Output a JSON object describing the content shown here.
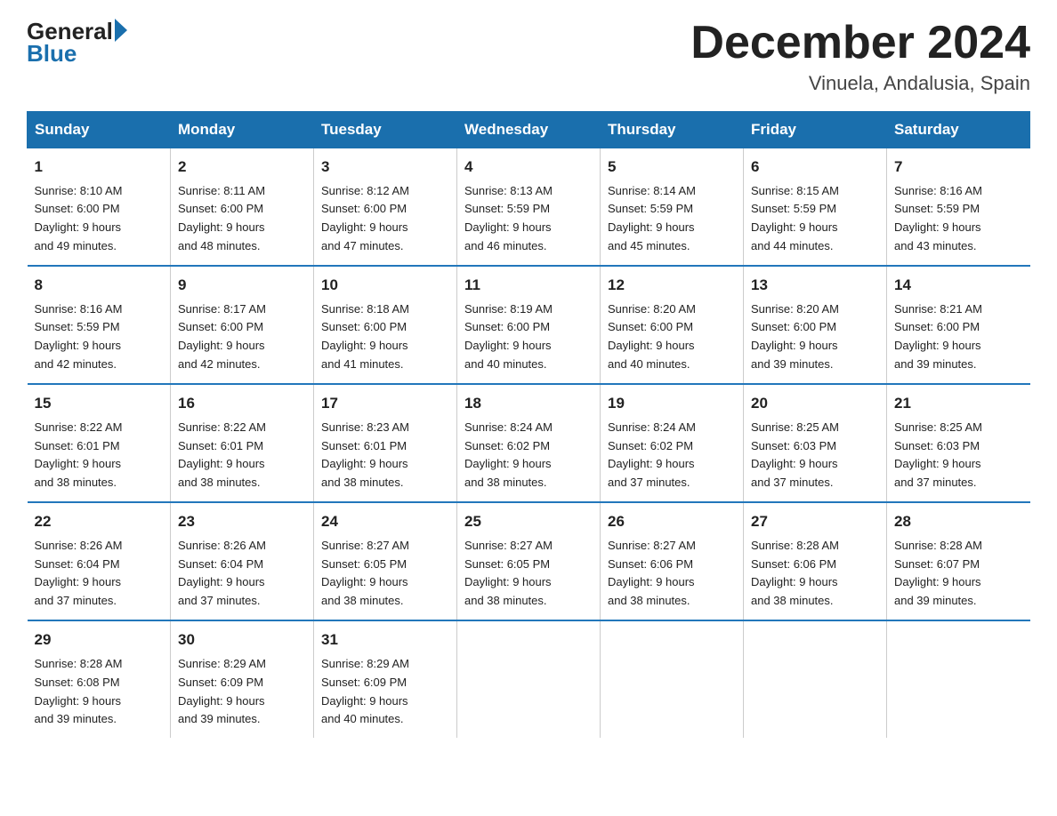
{
  "header": {
    "logo_general": "General",
    "logo_blue": "Blue",
    "month_title": "December 2024",
    "location": "Vinuela, Andalusia, Spain"
  },
  "days_of_week": [
    "Sunday",
    "Monday",
    "Tuesday",
    "Wednesday",
    "Thursday",
    "Friday",
    "Saturday"
  ],
  "weeks": [
    [
      {
        "day": "1",
        "sunrise": "8:10 AM",
        "sunset": "6:00 PM",
        "daylight": "9 hours and 49 minutes."
      },
      {
        "day": "2",
        "sunrise": "8:11 AM",
        "sunset": "6:00 PM",
        "daylight": "9 hours and 48 minutes."
      },
      {
        "day": "3",
        "sunrise": "8:12 AM",
        "sunset": "6:00 PM",
        "daylight": "9 hours and 47 minutes."
      },
      {
        "day": "4",
        "sunrise": "8:13 AM",
        "sunset": "5:59 PM",
        "daylight": "9 hours and 46 minutes."
      },
      {
        "day": "5",
        "sunrise": "8:14 AM",
        "sunset": "5:59 PM",
        "daylight": "9 hours and 45 minutes."
      },
      {
        "day": "6",
        "sunrise": "8:15 AM",
        "sunset": "5:59 PM",
        "daylight": "9 hours and 44 minutes."
      },
      {
        "day": "7",
        "sunrise": "8:16 AM",
        "sunset": "5:59 PM",
        "daylight": "9 hours and 43 minutes."
      }
    ],
    [
      {
        "day": "8",
        "sunrise": "8:16 AM",
        "sunset": "5:59 PM",
        "daylight": "9 hours and 42 minutes."
      },
      {
        "day": "9",
        "sunrise": "8:17 AM",
        "sunset": "6:00 PM",
        "daylight": "9 hours and 42 minutes."
      },
      {
        "day": "10",
        "sunrise": "8:18 AM",
        "sunset": "6:00 PM",
        "daylight": "9 hours and 41 minutes."
      },
      {
        "day": "11",
        "sunrise": "8:19 AM",
        "sunset": "6:00 PM",
        "daylight": "9 hours and 40 minutes."
      },
      {
        "day": "12",
        "sunrise": "8:20 AM",
        "sunset": "6:00 PM",
        "daylight": "9 hours and 40 minutes."
      },
      {
        "day": "13",
        "sunrise": "8:20 AM",
        "sunset": "6:00 PM",
        "daylight": "9 hours and 39 minutes."
      },
      {
        "day": "14",
        "sunrise": "8:21 AM",
        "sunset": "6:00 PM",
        "daylight": "9 hours and 39 minutes."
      }
    ],
    [
      {
        "day": "15",
        "sunrise": "8:22 AM",
        "sunset": "6:01 PM",
        "daylight": "9 hours and 38 minutes."
      },
      {
        "day": "16",
        "sunrise": "8:22 AM",
        "sunset": "6:01 PM",
        "daylight": "9 hours and 38 minutes."
      },
      {
        "day": "17",
        "sunrise": "8:23 AM",
        "sunset": "6:01 PM",
        "daylight": "9 hours and 38 minutes."
      },
      {
        "day": "18",
        "sunrise": "8:24 AM",
        "sunset": "6:02 PM",
        "daylight": "9 hours and 38 minutes."
      },
      {
        "day": "19",
        "sunrise": "8:24 AM",
        "sunset": "6:02 PM",
        "daylight": "9 hours and 37 minutes."
      },
      {
        "day": "20",
        "sunrise": "8:25 AM",
        "sunset": "6:03 PM",
        "daylight": "9 hours and 37 minutes."
      },
      {
        "day": "21",
        "sunrise": "8:25 AM",
        "sunset": "6:03 PM",
        "daylight": "9 hours and 37 minutes."
      }
    ],
    [
      {
        "day": "22",
        "sunrise": "8:26 AM",
        "sunset": "6:04 PM",
        "daylight": "9 hours and 37 minutes."
      },
      {
        "day": "23",
        "sunrise": "8:26 AM",
        "sunset": "6:04 PM",
        "daylight": "9 hours and 37 minutes."
      },
      {
        "day": "24",
        "sunrise": "8:27 AM",
        "sunset": "6:05 PM",
        "daylight": "9 hours and 38 minutes."
      },
      {
        "day": "25",
        "sunrise": "8:27 AM",
        "sunset": "6:05 PM",
        "daylight": "9 hours and 38 minutes."
      },
      {
        "day": "26",
        "sunrise": "8:27 AM",
        "sunset": "6:06 PM",
        "daylight": "9 hours and 38 minutes."
      },
      {
        "day": "27",
        "sunrise": "8:28 AM",
        "sunset": "6:06 PM",
        "daylight": "9 hours and 38 minutes."
      },
      {
        "day": "28",
        "sunrise": "8:28 AM",
        "sunset": "6:07 PM",
        "daylight": "9 hours and 39 minutes."
      }
    ],
    [
      {
        "day": "29",
        "sunrise": "8:28 AM",
        "sunset": "6:08 PM",
        "daylight": "9 hours and 39 minutes."
      },
      {
        "day": "30",
        "sunrise": "8:29 AM",
        "sunset": "6:09 PM",
        "daylight": "9 hours and 39 minutes."
      },
      {
        "day": "31",
        "sunrise": "8:29 AM",
        "sunset": "6:09 PM",
        "daylight": "9 hours and 40 minutes."
      },
      {
        "day": "",
        "sunrise": "",
        "sunset": "",
        "daylight": ""
      },
      {
        "day": "",
        "sunrise": "",
        "sunset": "",
        "daylight": ""
      },
      {
        "day": "",
        "sunrise": "",
        "sunset": "",
        "daylight": ""
      },
      {
        "day": "",
        "sunrise": "",
        "sunset": "",
        "daylight": ""
      }
    ]
  ],
  "labels": {
    "sunrise": "Sunrise:",
    "sunset": "Sunset:",
    "daylight": "Daylight:"
  }
}
